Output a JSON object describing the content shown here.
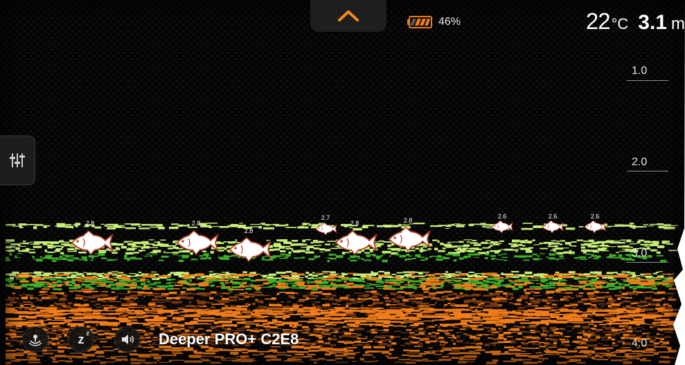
{
  "top_handle": {
    "icon": "chevron-up-icon"
  },
  "battery": {
    "percent_text": "46%",
    "level": 0.46,
    "color": "#f07d1a"
  },
  "readout": {
    "temperature": "22",
    "temperature_unit": "°C",
    "depth": "3.1",
    "depth_unit": "m"
  },
  "settings": {
    "icon": "sliders-icon"
  },
  "depth_scale": [
    "1.0",
    "2.0",
    "3.0",
    "4.0"
  ],
  "fish": [
    {
      "depth": "2.8",
      "size": "large"
    },
    {
      "depth": "2.8",
      "size": "large"
    },
    {
      "depth": "2.8",
      "size": "large"
    },
    {
      "depth": "2.7",
      "size": "small"
    },
    {
      "depth": "2.8",
      "size": "large"
    },
    {
      "depth": "2.8",
      "size": "large"
    },
    {
      "depth": "2.6",
      "size": "small"
    },
    {
      "depth": "2.6",
      "size": "small"
    },
    {
      "depth": "2.6",
      "size": "small"
    }
  ],
  "bottom_bar": {
    "buttons": [
      {
        "icon": "sonar-cast-icon"
      },
      {
        "icon": "sleep-icon",
        "text": "z"
      },
      {
        "icon": "speaker-icon"
      }
    ],
    "device_name": "Deeper PRO+ C2E8"
  },
  "colors": {
    "sonar_green": "#3fae2a",
    "sonar_light_green": "#c9f07a",
    "sonar_orange": "#f07d1a",
    "accent_orange": "#f28a1c"
  }
}
